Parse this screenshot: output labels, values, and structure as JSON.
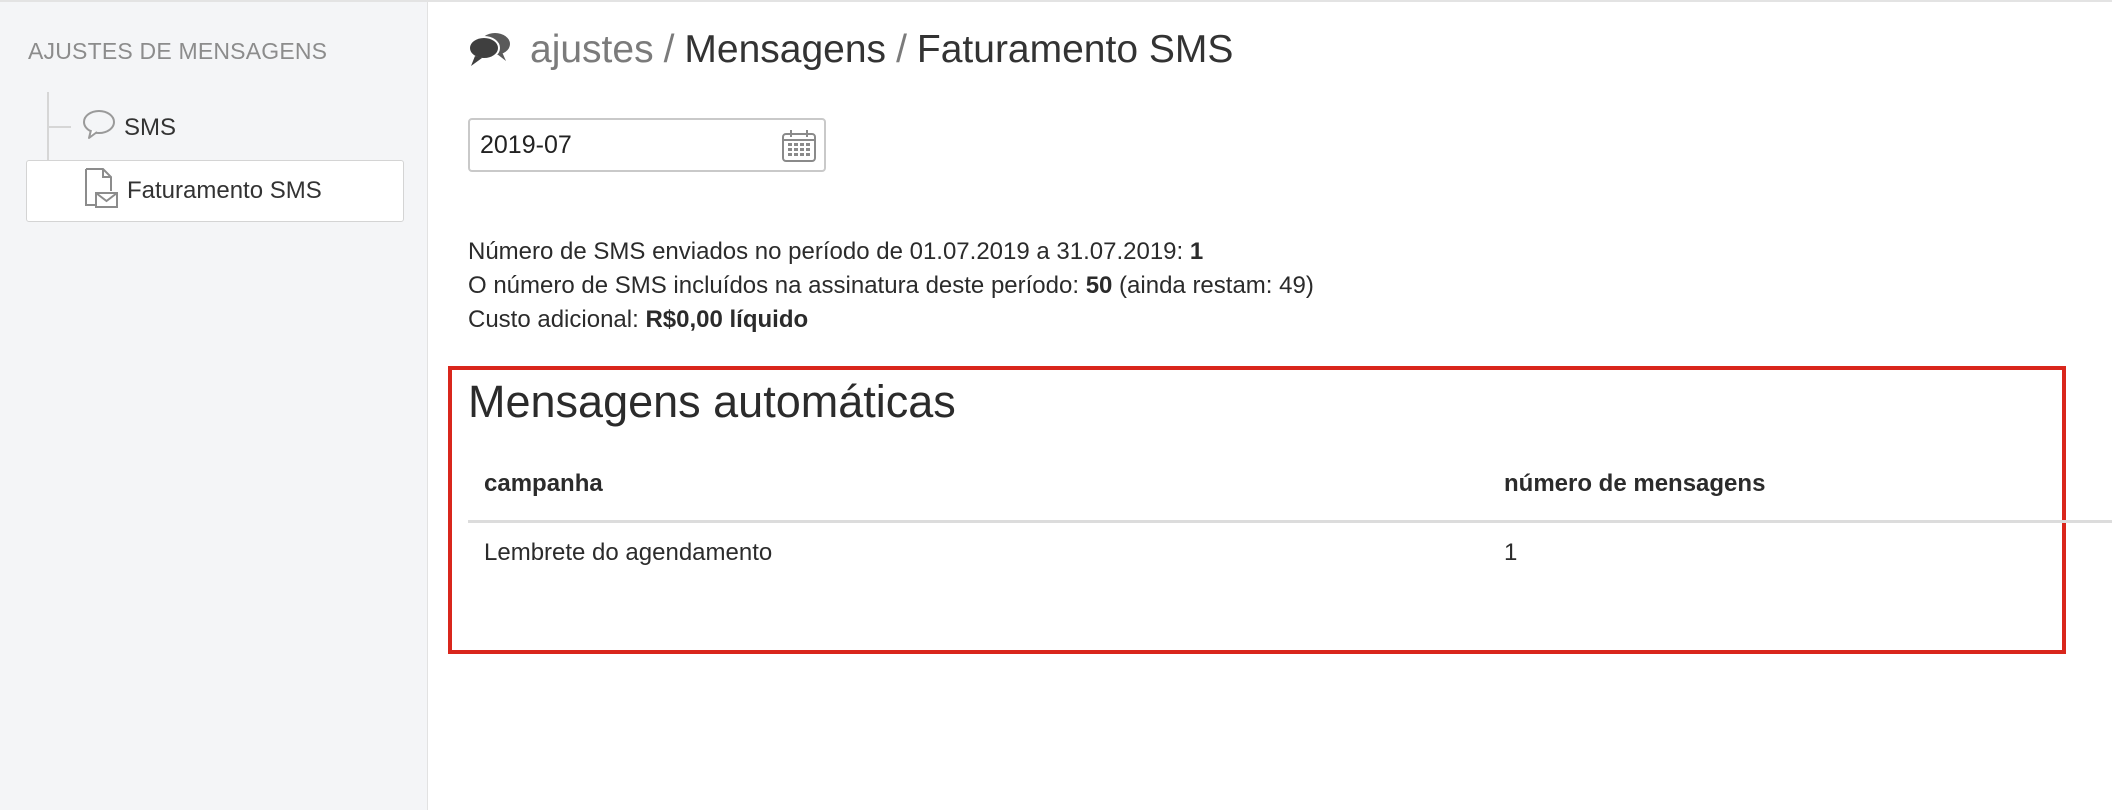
{
  "sidebar": {
    "heading": "AJUSTES DE MENSAGENS",
    "items": [
      {
        "label": "SMS",
        "icon": "speech-bubble-icon"
      },
      {
        "label": "Faturamento SMS",
        "icon": "document-envelope-icon",
        "selected": true
      }
    ]
  },
  "breadcrumb": {
    "icon": "chat-bubbles-icon",
    "parts": [
      "ajustes",
      "Mensagens",
      "Faturamento SMS"
    ],
    "separator": "/"
  },
  "date_field": {
    "value": "2019-07",
    "icon": "calendar-icon"
  },
  "summary": {
    "line1_text": "Número de SMS enviados no período de 01.07.2019 a 31.07.2019: ",
    "line1_value": "1",
    "line2_text": "O número de SMS incluídos na assinatura deste período: ",
    "line2_value": "50",
    "line2_suffix": " (ainda restam: 49)",
    "line3_text": "Custo adicional: ",
    "line3_value": "R$0,00 líquido"
  },
  "automatic_messages": {
    "title": "Mensagens automáticas",
    "columns": [
      "campanha",
      "número de mensagens"
    ],
    "rows": [
      [
        "Lembrete do agendamento",
        "1"
      ]
    ]
  },
  "colors": {
    "highlight_border": "#d9261c",
    "sidebar_bg": "#f4f5f7"
  }
}
